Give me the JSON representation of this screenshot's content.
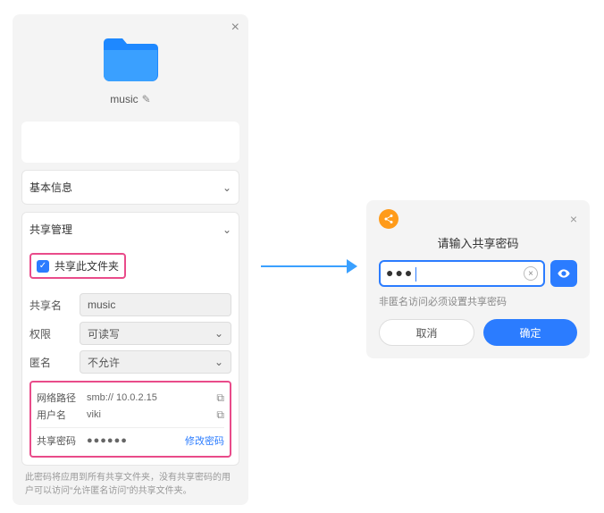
{
  "panel": {
    "folder_name": "music",
    "sections": {
      "basic": "基本信息",
      "share": "共享管理"
    },
    "share": {
      "checkbox_label": "共享此文件夹",
      "name_label": "共享名",
      "name_value": "music",
      "perm_label": "权限",
      "perm_value": "可读写",
      "anon_label": "匿名",
      "anon_value": "不允许",
      "netpath_label": "网络路径",
      "netpath_value": "smb:// 10.0.2.15",
      "user_label": "用户名",
      "user_value": "viki",
      "pwd_label": "共享密码",
      "pwd_value": "●●●●●●",
      "change_pwd": "修改密码"
    },
    "footnote": "此密码将应用到所有共享文件夹，没有共享密码的用户可以访问“允许匿名访问”的共享文件夹。"
  },
  "dialog": {
    "title": "请输入共享密码",
    "mask": "●●●",
    "hint": "非匿名访问必须设置共享密码",
    "cancel": "取消",
    "ok": "确定"
  }
}
